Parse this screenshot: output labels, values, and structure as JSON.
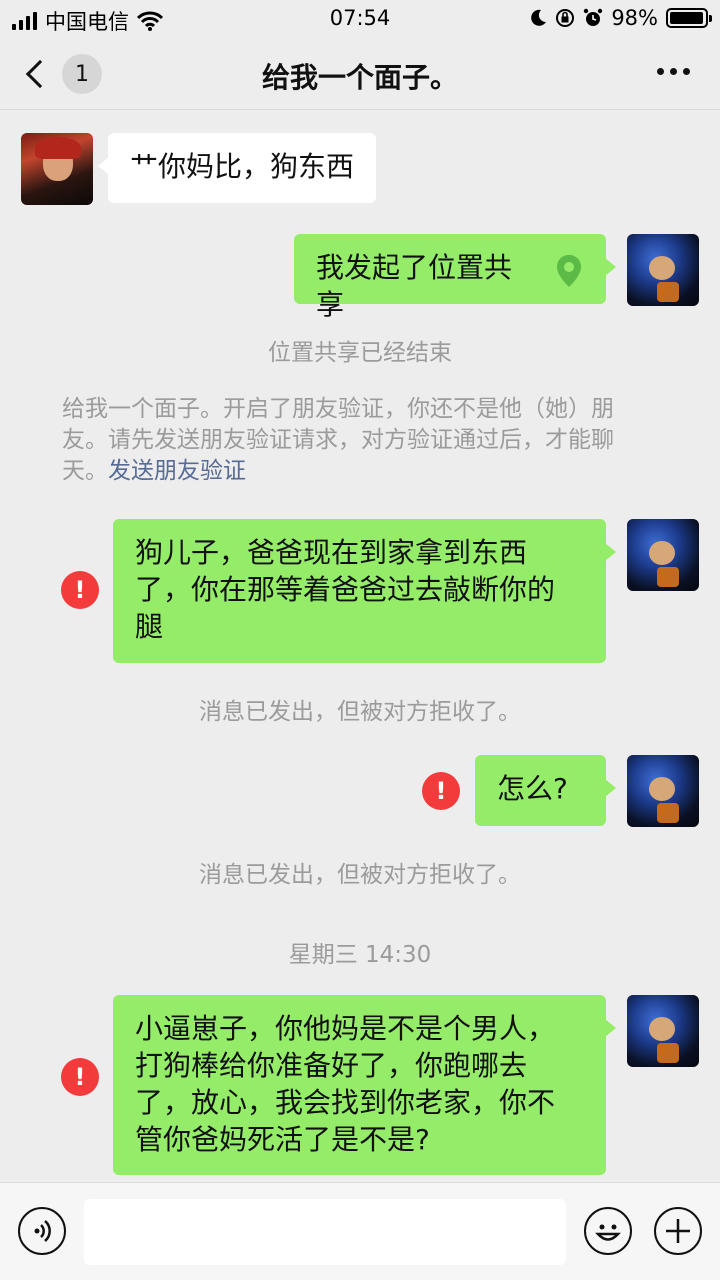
{
  "status_bar": {
    "carrier": "中国电信",
    "time": "07:54",
    "battery_percent": "98%",
    "battery_level": 0.98
  },
  "nav": {
    "unread_count": "1",
    "title": "给我一个面子。"
  },
  "messages": {
    "m1": "艹你妈比，狗东西",
    "m2": "我发起了位置共享",
    "m3_lines": [
      "狗儿子，爸爸现在到家拿到东西",
      "了，你在那等着爸爸过去敲断你的",
      "腿"
    ],
    "m4": "怎么?",
    "m5_lines": [
      "小逼崽子，你他妈是不是个男人，",
      "打狗棒给你准备好了，你跑哪去",
      "了，放心，我会找到你老家，你不",
      "管你爸妈死活了是不是?"
    ]
  },
  "system": {
    "location_ended": "位置共享已经结束",
    "verify_lines": [
      "给我一个面子。开启了朋友验证，你还不是他（她）朋",
      "友。请先发送朋友验证请求，对方验证通过后，才能聊"
    ],
    "verify_last": "天。",
    "verify_link": "发送朋友验证",
    "rejected_1": "消息已发出，但被对方拒收了。",
    "rejected_2": "消息已发出，但被对方拒收了。",
    "timestamp": "星期三 14:30"
  },
  "icons": {
    "error": "!",
    "pin_color": "#5cba47",
    "error_color": "#f33b3b",
    "bubble_out_color": "#95ec69"
  }
}
